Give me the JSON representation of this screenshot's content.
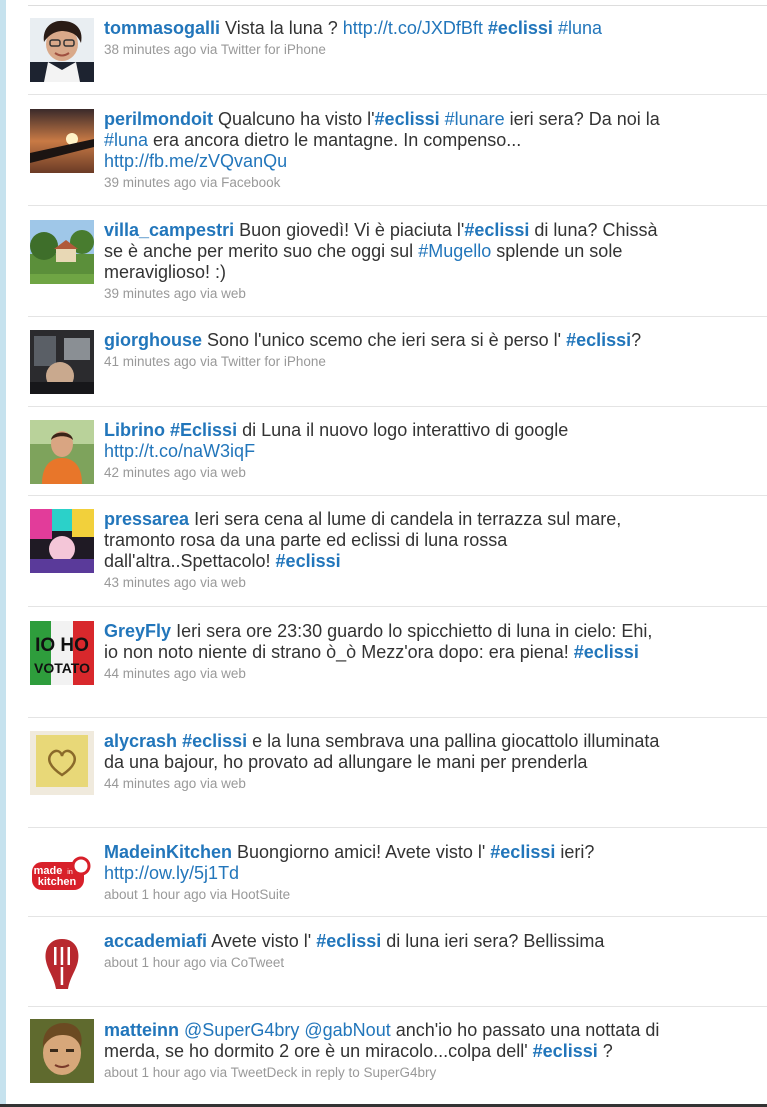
{
  "tweets": [
    {
      "user": "tommasogalli",
      "parts": [
        {
          "t": "text",
          "v": "Vista la luna ? "
        },
        {
          "t": "link",
          "v": "http://t.co/JXDfBft"
        },
        {
          "t": "text",
          "v": " "
        },
        {
          "t": "tag",
          "v": "#eclissi"
        },
        {
          "t": "text",
          "v": " "
        },
        {
          "t": "taglight",
          "v": "#luna"
        }
      ],
      "time": "38 minutes ago",
      "via_word": "via",
      "source": "Twitter for iPhone",
      "reply": "",
      "avatar": "person-curly-hair"
    },
    {
      "user": "perilmondoit",
      "parts": [
        {
          "t": "text",
          "v": "Qualcuno ha visto l'"
        },
        {
          "t": "tag",
          "v": "#eclissi"
        },
        {
          "t": "text",
          "v": " "
        },
        {
          "t": "taglight",
          "v": "#lunare"
        },
        {
          "t": "text",
          "v": " ieri sera? Da noi la "
        },
        {
          "t": "taglight",
          "v": "#luna"
        },
        {
          "t": "text",
          "v": " era ancora dietro le mantagne. In compenso... "
        },
        {
          "t": "link",
          "v": "http://fb.me/zVQvanQu"
        }
      ],
      "time": "39 minutes ago",
      "via_word": "via",
      "source": "Facebook",
      "reply": "",
      "avatar": "airplane-wing-sunset"
    },
    {
      "user": "villa_campestri",
      "parts": [
        {
          "t": "text",
          "v": "Buon giovedì! Vi è piaciuta l'"
        },
        {
          "t": "tag",
          "v": "#eclissi"
        },
        {
          "t": "text",
          "v": " di luna? Chissà se è anche per merito suo che oggi sul "
        },
        {
          "t": "taglight",
          "v": "#Mugello"
        },
        {
          "t": "text",
          "v": " splende un sole meraviglioso! :)"
        }
      ],
      "time": "39 minutes ago",
      "via_word": "via",
      "source": "web",
      "reply": "",
      "avatar": "countryside-villa"
    },
    {
      "user": "giorghouse",
      "parts": [
        {
          "t": "text",
          "v": "Sono l'unico scemo che ieri sera si è perso l' "
        },
        {
          "t": "tag",
          "v": "#eclissi"
        },
        {
          "t": "text",
          "v": "?"
        }
      ],
      "time": "41 minutes ago",
      "via_word": "via",
      "source": "Twitter for iPhone",
      "reply": "",
      "avatar": "dark-interior"
    },
    {
      "user": "Librino",
      "parts": [
        {
          "t": "text",
          "v": " "
        },
        {
          "t": "tag",
          "v": "#Eclissi"
        },
        {
          "t": "text",
          "v": " di Luna il nuovo logo interattivo di google "
        },
        {
          "t": "link",
          "v": "http://t.co/naW3iqF"
        }
      ],
      "time": "42 minutes ago",
      "via_word": "via",
      "source": "web",
      "reply": "",
      "avatar": "man-orange-shirt"
    },
    {
      "user": "pressarea",
      "parts": [
        {
          "t": "text",
          "v": "Ieri sera cena al lume di candela in terrazza sul mare, tramonto rosa da una parte ed eclissi di luna rossa dall'altra..Spettacolo! "
        },
        {
          "t": "tag",
          "v": "#eclissi"
        }
      ],
      "time": "43 minutes ago",
      "via_word": "via",
      "source": "web",
      "reply": "",
      "avatar": "colorful-collage"
    },
    {
      "user": "GreyFly",
      "parts": [
        {
          "t": "text",
          "v": "Ieri sera ore 23:30 guardo lo spicchietto di luna in cielo: Ehi, io non noto niente di strano ò_ò Mezz'ora dopo: era piena! "
        },
        {
          "t": "tag",
          "v": "#eclissi"
        }
      ],
      "time": "44 minutes ago",
      "via_word": "via",
      "source": "web",
      "reply": "",
      "avatar": "io-ho-votato",
      "avatar_text": [
        "IO HO",
        "VOTATO"
      ]
    },
    {
      "user": "alycrash",
      "parts": [
        {
          "t": "text",
          "v": " "
        },
        {
          "t": "tag",
          "v": "#eclissi"
        },
        {
          "t": "text",
          "v": " e la luna sembrava una pallina giocattolo illuminata da una bajour, ho provato ad allungare le mani per prenderla"
        }
      ],
      "time": "44 minutes ago",
      "via_word": "via",
      "source": "web",
      "reply": "",
      "avatar": "heart-doodle"
    },
    {
      "user": "MadeinKitchen",
      "parts": [
        {
          "t": "text",
          "v": "Buongiorno amici! Avete visto l' "
        },
        {
          "t": "tag",
          "v": "#eclissi"
        },
        {
          "t": "text",
          "v": " ieri? "
        },
        {
          "t": "link",
          "v": "http://ow.ly/5j1Td"
        }
      ],
      "time": "about 1 hour ago",
      "via_word": "via",
      "source": "HootSuite",
      "reply": "",
      "avatar": "made-in-kitchen-logo",
      "avatar_text": [
        "made",
        "in",
        "kitchen"
      ]
    },
    {
      "user": "accademiafi",
      "parts": [
        {
          "t": "text",
          "v": "Avete visto l' "
        },
        {
          "t": "tag",
          "v": "#eclissi"
        },
        {
          "t": "text",
          "v": " di luna ieri sera? Bellissima"
        }
      ],
      "time": "about 1 hour ago",
      "via_word": "via",
      "source": "CoTweet",
      "reply": "",
      "avatar": "fork-knife-logo"
    },
    {
      "user": "matteinn",
      "parts": [
        {
          "t": "mention",
          "v": "@SuperG4bry"
        },
        {
          "t": "text",
          "v": " "
        },
        {
          "t": "mention",
          "v": "@gabNout"
        },
        {
          "t": "text",
          "v": " anch'io ho passato una nottata di merda, se ho dormito 2 ore è un miracolo...colpa dell' "
        },
        {
          "t": "tag",
          "v": "#eclissi"
        },
        {
          "t": "text",
          "v": " ?"
        }
      ],
      "time": "about 1 hour ago",
      "via_word": "via",
      "source": "TweetDeck",
      "reply": "in reply to SuperG4bry",
      "avatar": "young-man-portrait"
    }
  ],
  "colors": {
    "link": "#2276bb",
    "text": "#333333",
    "meta": "#999999",
    "divider": "#e4e4e4",
    "accent_bar": "#c6e2ee"
  }
}
